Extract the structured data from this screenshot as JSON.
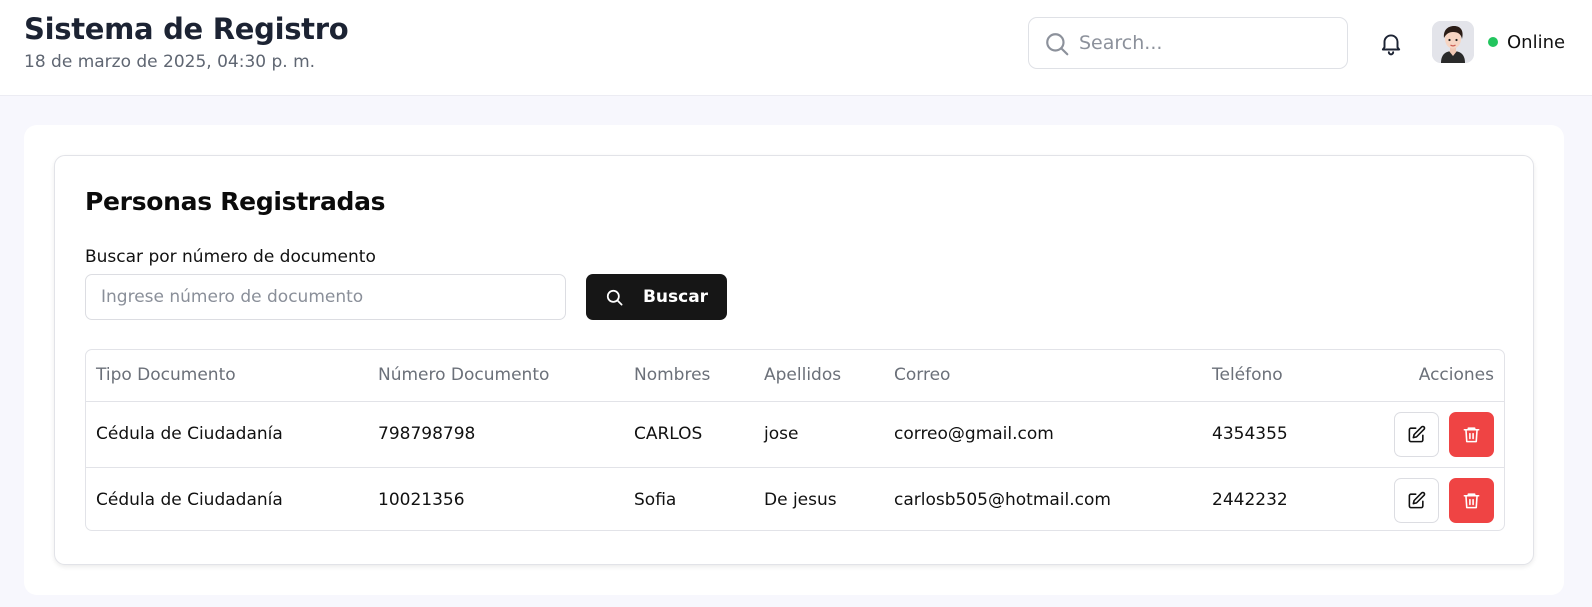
{
  "header": {
    "title": "Sistema de Registro",
    "date": "18 de marzo de 2025, 04:30 p. m.",
    "search_placeholder": "Search...",
    "status_label": "Online"
  },
  "card": {
    "title": "Personas Registradas",
    "search_label": "Buscar por número de documento",
    "search_placeholder": "Ingrese número de documento",
    "search_button": "Buscar"
  },
  "table": {
    "columns": [
      "Tipo Documento",
      "Número Documento",
      "Nombres",
      "Apellidos",
      "Correo",
      "Teléfono",
      "Acciones"
    ],
    "rows": [
      {
        "tipo": "Cédula de Ciudadanía",
        "numero": "798798798",
        "nombres": "CARLOS",
        "apellidos": "jose",
        "correo": "correo@gmail.com",
        "telefono": "4354355"
      },
      {
        "tipo": "Cédula de Ciudadanía",
        "numero": "10021356",
        "nombres": "Sofia",
        "apellidos": "De jesus",
        "correo": "carlosb505@hotmail.com",
        "telefono": "2442232"
      }
    ]
  },
  "icons": {
    "search": "search-icon",
    "notifications": "bell-icon",
    "edit": "edit-icon",
    "delete": "trash-icon"
  },
  "colors": {
    "status_online": "#22c55e",
    "primary_button": "#161616",
    "delete_button": "#ef4444",
    "page_background": "#f7f7fd"
  }
}
